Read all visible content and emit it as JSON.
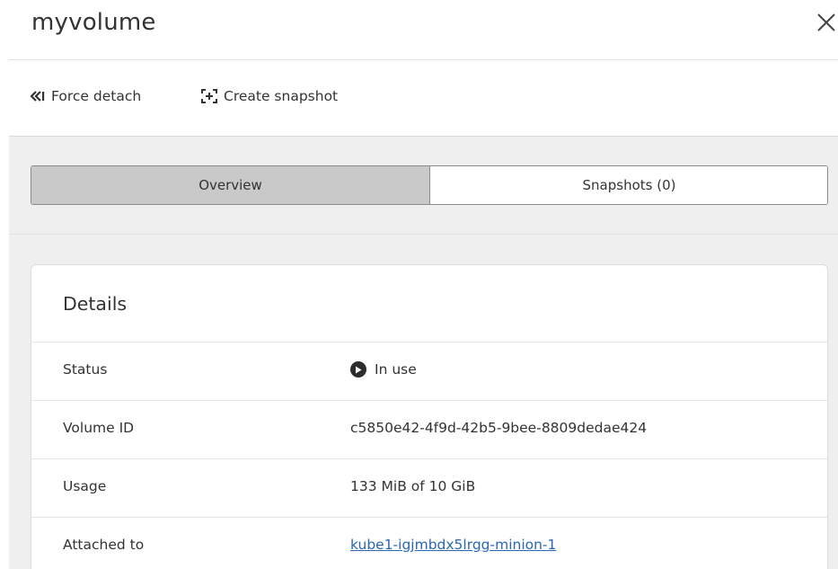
{
  "panel": {
    "title": "myvolume"
  },
  "toolbar": {
    "force_detach_label": "Force detach",
    "create_snapshot_label": "Create snapshot"
  },
  "tabs": [
    {
      "label": "Overview",
      "active": true
    },
    {
      "label": "Snapshots (0)",
      "active": false
    }
  ],
  "details": {
    "title": "Details",
    "rows": [
      {
        "label": "Status",
        "value": "In use",
        "icon": "play-circle-icon"
      },
      {
        "label": "Volume ID",
        "value": "c5850e42-4f9d-42b5-9bee-8809dedae424"
      },
      {
        "label": "Usage",
        "value": "133 MiB of 10 GiB"
      },
      {
        "label": "Attached to",
        "value": "kube1-igjmbdx5lrgg-minion-1",
        "link": true
      }
    ]
  },
  "colors": {
    "active_tab": "#c9c9c9",
    "link": "#2b67b5",
    "content_background": "#efefef"
  }
}
